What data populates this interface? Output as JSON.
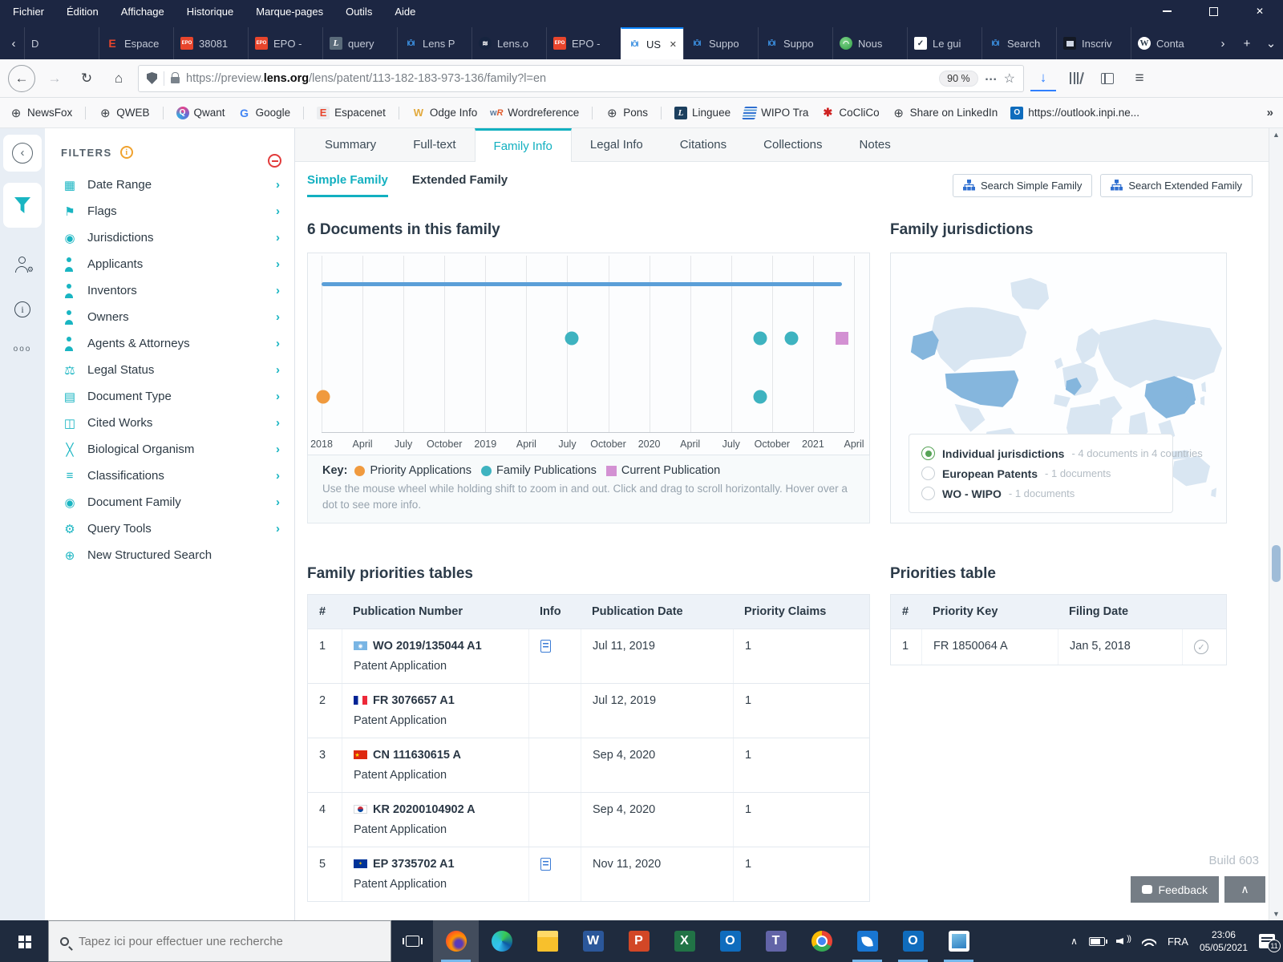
{
  "browser": {
    "menu_items": [
      "Fichier",
      "Édition",
      "Affichage",
      "Historique",
      "Marque-pages",
      "Outils",
      "Aide"
    ],
    "tabs": [
      {
        "label": "D",
        "icon": "",
        "state": ""
      },
      {
        "label": "Espace",
        "icon": "ic-espacenet",
        "state": ""
      },
      {
        "label": "38081",
        "icon": "ic-epo",
        "state": ""
      },
      {
        "label": "EPO -",
        "icon": "ic-epo",
        "state": ""
      },
      {
        "label": "query",
        "icon": "ic-linguee",
        "state": ""
      },
      {
        "label": "Lens P",
        "icon": "ic-lens",
        "state": ""
      },
      {
        "label": "Lens.o",
        "icon": "ic-lensorg",
        "state": ""
      },
      {
        "label": "EPO -",
        "icon": "ic-epo",
        "state": ""
      },
      {
        "label": "US",
        "icon": "ic-lens",
        "state": "active"
      },
      {
        "label": "Suppo",
        "icon": "ic-lens",
        "state": ""
      },
      {
        "label": "Suppo",
        "icon": "ic-lens",
        "state": ""
      },
      {
        "label": "Nous",
        "icon": "ic-green",
        "state": ""
      },
      {
        "label": "Le gui",
        "icon": "ic-guide",
        "state": ""
      },
      {
        "label": "Search",
        "icon": "ic-lens",
        "state": ""
      },
      {
        "label": "Inscriv",
        "icon": "ic-inscr",
        "state": ""
      },
      {
        "label": "Conta",
        "icon": "ic-wp",
        "state": ""
      }
    ],
    "url_prefix": "https://preview.",
    "url_domain": "lens.org",
    "url_path": "/lens/patent/113-182-183-973-136/family?l=en",
    "zoom_badge": "90 %",
    "bookmarks": [
      {
        "label": "NewsFox",
        "icon": "bk-globe",
        "sep": "sep"
      },
      {
        "label": "QWEB",
        "icon": "bk-globe",
        "sep": "sep"
      },
      {
        "label": "Qwant",
        "icon": "bk-qwant",
        "sep": ""
      },
      {
        "label": "Google",
        "icon": "bk-google",
        "sep": "sep"
      },
      {
        "label": "Espacenet",
        "icon": "bk-espacenet",
        "sep": "sep"
      },
      {
        "label": "Odge Info",
        "icon": "bk-wodge",
        "sep": ""
      },
      {
        "label": "Wordreference",
        "icon": "bk-wordref",
        "sep": "sep"
      },
      {
        "label": "Pons",
        "icon": "bk-globe",
        "sep": "sep"
      },
      {
        "label": "Linguee",
        "icon": "bk-linguee",
        "sep": ""
      },
      {
        "label": "WIPO Tra",
        "icon": "bk-wipo",
        "sep": ""
      },
      {
        "label": "CoCliCo",
        "icon": "bk-coclico",
        "sep": ""
      },
      {
        "label": "Share on LinkedIn",
        "icon": "bk-globe",
        "sep": ""
      },
      {
        "label": "https://outlook.inpi.ne...",
        "icon": "bk-outlook",
        "sep": ""
      }
    ]
  },
  "sidebar": {
    "title": "FILTERS",
    "items": [
      {
        "label": "Date Range",
        "icon": "calendar-icon",
        "chevron": ""
      },
      {
        "label": "Flags",
        "icon": "flag-icon",
        "chevron": ""
      },
      {
        "label": "Jurisdictions",
        "icon": "pin-icon",
        "chevron": ""
      },
      {
        "label": "Applicants",
        "icon": "user-check-icon",
        "chevron": ""
      },
      {
        "label": "Inventors",
        "icon": "user-plus-icon",
        "chevron": ""
      },
      {
        "label": "Owners",
        "icon": "user-icon",
        "chevron": ""
      },
      {
        "label": "Agents & Attorneys",
        "icon": "user-pen-icon",
        "chevron": ""
      },
      {
        "label": "Legal Status",
        "icon": "gavel-icon",
        "chevron": ""
      },
      {
        "label": "Document Type",
        "icon": "document-icon",
        "chevron": ""
      },
      {
        "label": "Cited Works",
        "icon": "books-icon",
        "chevron": ""
      },
      {
        "label": "Biological Organism",
        "icon": "dna-icon",
        "chevron": ""
      },
      {
        "label": "Classifications",
        "icon": "list-icon",
        "chevron": ""
      },
      {
        "label": "Document Family",
        "icon": "pin-icon",
        "chevron": ""
      },
      {
        "label": "Query Tools",
        "icon": "gears-icon",
        "chevron": ""
      },
      {
        "label": "New Structured Search",
        "icon": "search-plus-icon",
        "chevron": "hide"
      }
    ]
  },
  "page": {
    "tabs": [
      {
        "label": "Summary",
        "state": ""
      },
      {
        "label": "Full-text",
        "state": ""
      },
      {
        "label": "Family Info",
        "state": "active"
      },
      {
        "label": "Legal Info",
        "state": ""
      },
      {
        "label": "Citations",
        "state": ""
      },
      {
        "label": "Collections",
        "state": ""
      },
      {
        "label": "Notes",
        "state": ""
      }
    ],
    "family_tabs": [
      {
        "label": "Simple Family",
        "state": "active"
      },
      {
        "label": "Extended Family",
        "state": ""
      }
    ],
    "search_buttons": [
      {
        "label": "Search Simple Family"
      },
      {
        "label": "Search Extended Family"
      }
    ]
  },
  "chart_data": {
    "type": "scatter",
    "title": "6 Documents in this family",
    "x_axis": {
      "ticks": [
        "2018",
        "April",
        "July",
        "October",
        "2019",
        "April",
        "July",
        "October",
        "2020",
        "April",
        "July",
        "October",
        "2021",
        "April"
      ],
      "start": "2018-01",
      "months_per_tick": 3,
      "total_months": 39
    },
    "timeline_bar": {
      "from_month": 0,
      "to_month": 38.1,
      "color": "#5b9fd8"
    },
    "series": [
      {
        "name": "Priority Applications",
        "color": "#f09a3e",
        "shape": "circle",
        "points": [
          {
            "date": "Jan 5, 2018",
            "month": 0.1,
            "row": "low"
          }
        ]
      },
      {
        "name": "Family Publications",
        "color": "#3eb3c0",
        "shape": "circle",
        "points": [
          {
            "date": "Jul 11, 2019",
            "month": 18.3,
            "row": "mid"
          },
          {
            "date": "Sep 4, 2020",
            "month": 32.1,
            "row": "mid"
          },
          {
            "date": "Sep 4, 2020",
            "month": 32.1,
            "row": "low"
          },
          {
            "date": "Nov 11, 2020",
            "month": 34.4,
            "row": "mid"
          }
        ]
      },
      {
        "name": "Current Publication",
        "color": "#d391d3",
        "shape": "square",
        "points": [
          {
            "date": "Mar 2021",
            "month": 38.1,
            "row": "mid"
          }
        ]
      }
    ],
    "key_label": "Key:",
    "help_text": "Use the mouse wheel while holding shift to zoom in and out. Click and drag to scroll horizontally. Hover over a dot to see more info."
  },
  "jurisdictions": {
    "title": "Family jurisdictions",
    "highlighted_countries": [
      "US",
      "FR",
      "CN",
      "KR"
    ],
    "options": [
      {
        "label": "Individual jurisdictions",
        "detail": "- 4 documents in 4 countries",
        "state": "selected"
      },
      {
        "label": "European Patents",
        "detail": "- 1 documents",
        "state": ""
      },
      {
        "label": "WO - WIPO",
        "detail": "- 1 documents",
        "state": ""
      }
    ]
  },
  "family_table": {
    "title": "Family priorities tables",
    "headers": [
      "#",
      "Publication Number",
      "Info",
      "Publication Date",
      "Priority Claims"
    ],
    "rows": [
      {
        "num": "1",
        "flag": "flag-wo",
        "pub": "WO 2019/135044 A1",
        "type": "Patent Application",
        "info": "doc",
        "date": "Jul 11, 2019",
        "claims": "1"
      },
      {
        "num": "2",
        "flag": "flag-fr",
        "pub": "FR 3076657 A1",
        "type": "Patent Application",
        "info": "",
        "date": "Jul 12, 2019",
        "claims": "1"
      },
      {
        "num": "3",
        "flag": "flag-cn",
        "pub": "CN 111630615 A",
        "type": "Patent Application",
        "info": "",
        "date": "Sep 4, 2020",
        "claims": "1"
      },
      {
        "num": "4",
        "flag": "flag-kr",
        "pub": "KR 20200104902 A",
        "type": "Patent Application",
        "info": "",
        "date": "Sep 4, 2020",
        "claims": "1"
      },
      {
        "num": "5",
        "flag": "flag-ep",
        "pub": "EP 3735702 A1",
        "type": "Patent Application",
        "info": "doc",
        "date": "Nov 11, 2020",
        "claims": "1"
      }
    ]
  },
  "priority_table": {
    "title": "Priorities table",
    "headers": [
      "#",
      "Priority Key",
      "Filing Date"
    ],
    "rows": [
      {
        "num": "1",
        "key": "FR 1850064 A",
        "date": "Jan 5, 2018",
        "status": "check"
      }
    ]
  },
  "footer": {
    "build": "Build 603",
    "feedback": "Feedback"
  },
  "taskbar": {
    "search_placeholder": "Tapez ici pour effectuer une recherche",
    "apps": [
      {
        "icon": "app-firefox",
        "state": "active open"
      },
      {
        "icon": "app-edge",
        "state": ""
      },
      {
        "icon": "app-explorer",
        "state": ""
      },
      {
        "icon": "app-word",
        "state": ""
      },
      {
        "icon": "app-ppt",
        "state": ""
      },
      {
        "icon": "app-excel",
        "state": ""
      },
      {
        "icon": "app-outlook",
        "state": ""
      },
      {
        "icon": "app-teams",
        "state": ""
      },
      {
        "icon": "app-chrome",
        "state": ""
      },
      {
        "icon": "app-feather",
        "state": "open"
      },
      {
        "icon": "app-outlook2",
        "state": "open"
      },
      {
        "icon": "app-photos",
        "state": "open"
      }
    ],
    "language": "FRA",
    "time": "23:06",
    "date": "05/05/2021",
    "notifications_badge": "11"
  },
  "colors": {
    "accent_teal": "#12b0c0",
    "link_blue": "#2f6fd0",
    "chrome_navy": "#1c2642",
    "taskbar_navy": "#1f2b3e"
  }
}
